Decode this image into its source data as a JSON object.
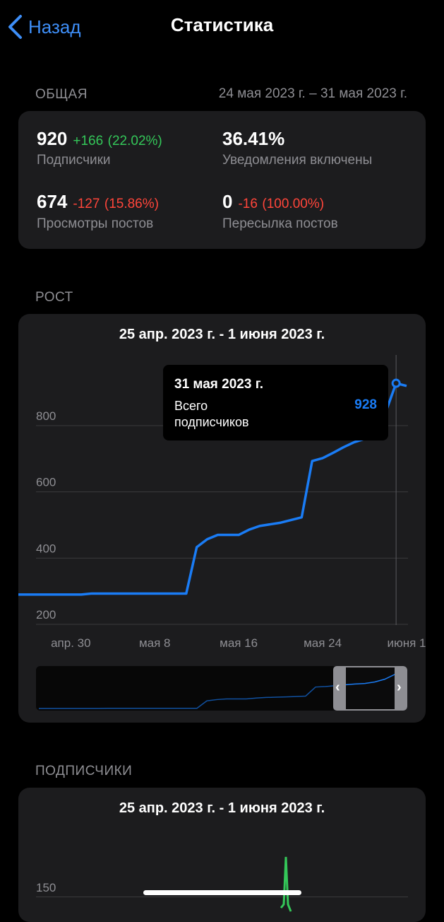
{
  "nav": {
    "back_label": "Назад",
    "title": "Статистика"
  },
  "overview": {
    "header": "ОБЩАЯ",
    "date_range": "24 мая 2023 г. – 31 мая 2023 г.",
    "stats": {
      "subscribers": {
        "value": "920",
        "delta": "+166",
        "pct": "(22.02%)",
        "label": "Подписчики"
      },
      "notifications": {
        "value": "36.41%",
        "label": "Уведомления включены"
      },
      "views": {
        "value": "674",
        "delta": "-127",
        "pct": "(15.86%)",
        "label": "Просмотры постов"
      },
      "shares": {
        "value": "0",
        "delta": "-16",
        "pct": "(100.00%)",
        "label": "Пересылка постов"
      }
    },
    "colors": {
      "positive": "#34c759",
      "negative": "#ff453a"
    }
  },
  "growth": {
    "header": "РОСТ",
    "range": "25 апр. 2023 г. - 1 июня 2023 г.",
    "tooltip": {
      "date": "31 мая 2023 г.",
      "label_line1": "Всего",
      "label_line2": "подписчиков",
      "value": "928"
    }
  },
  "subscribers_section": {
    "header": "ПОДПИСЧИКИ",
    "range": "25 апр. 2023 г. - 1 июня 2023 г.",
    "ytick": "150"
  },
  "chart_data": [
    {
      "type": "line",
      "title": "25 апр. 2023 г. - 1 июня 2023 г.",
      "series": [
        {
          "color": "#1a7cf5",
          "x": [
            "2023-04-25",
            "2023-04-26",
            "2023-04-27",
            "2023-04-28",
            "2023-04-29",
            "2023-04-30",
            "2023-05-01",
            "2023-05-02",
            "2023-05-03",
            "2023-05-04",
            "2023-05-05",
            "2023-05-06",
            "2023-05-07",
            "2023-05-08",
            "2023-05-09",
            "2023-05-10",
            "2023-05-11",
            "2023-05-12",
            "2023-05-13",
            "2023-05-14",
            "2023-05-15",
            "2023-05-16",
            "2023-05-17",
            "2023-05-18",
            "2023-05-19",
            "2023-05-20",
            "2023-05-21",
            "2023-05-22",
            "2023-05-23",
            "2023-05-24",
            "2023-05-25",
            "2023-05-26",
            "2023-05-27",
            "2023-05-28",
            "2023-05-29",
            "2023-05-30",
            "2023-05-31",
            "2023-06-01"
          ],
          "values": [
            290,
            290,
            290,
            290,
            290,
            290,
            290,
            293,
            293,
            293,
            293,
            293,
            293,
            293,
            293,
            293,
            293,
            433,
            457,
            470,
            470,
            470,
            486,
            497,
            502,
            507,
            515,
            523,
            693,
            702,
            718,
            735,
            750,
            760,
            788,
            840,
            928,
            920
          ]
        }
      ],
      "y_ticks": [
        200,
        400,
        600,
        800
      ],
      "x_ticks": [
        "апр. 30",
        "мая 8",
        "мая 16",
        "мая 24",
        "июня 1"
      ],
      "ylim": [
        200,
        980
      ],
      "grid": true,
      "highlight": {
        "x": "2023-05-31",
        "value": 928
      }
    },
    {
      "type": "line",
      "title": "25 апр. 2023 г. - 1 июня 2023 г.",
      "series": [
        {
          "color": "#34c759"
        }
      ],
      "y_ticks": [
        150
      ]
    }
  ]
}
